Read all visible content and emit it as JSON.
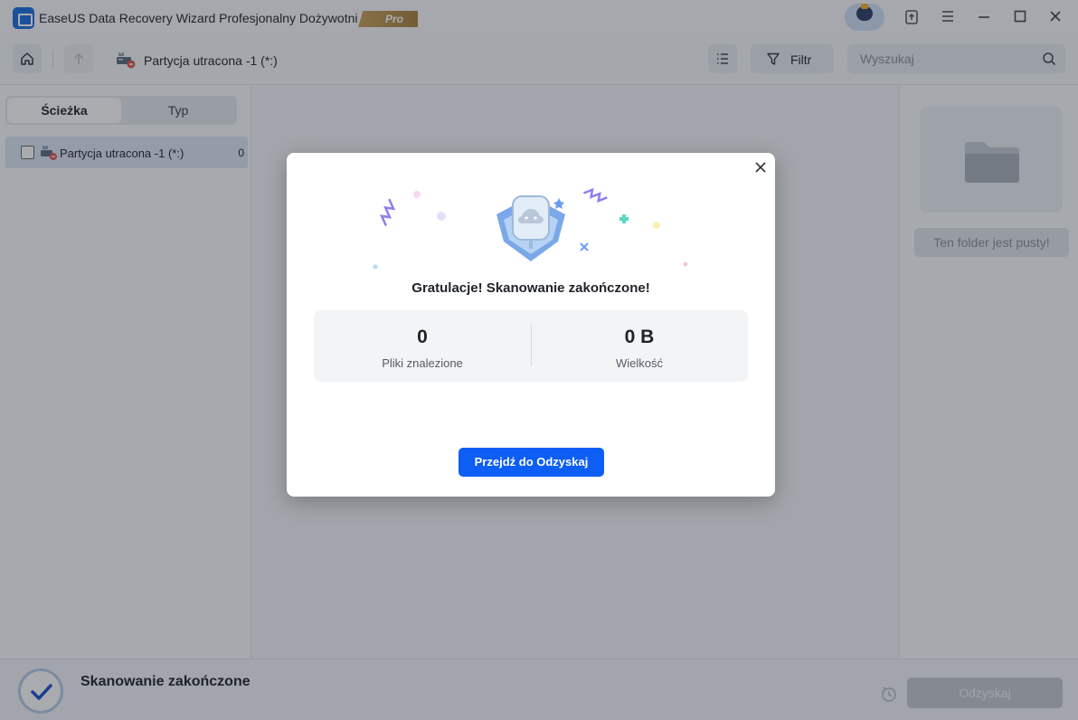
{
  "titlebar": {
    "app_title": "EaseUS Data Recovery Wizard Profesjonalny Dożywotni",
    "pro_badge": "Pro"
  },
  "toolbar": {
    "location": "Partycja utracona -1 (*:)",
    "filter_label": "Filtr",
    "search_placeholder": "Wyszukaj"
  },
  "left_panel": {
    "tabs": [
      {
        "label": "Ścieżka",
        "active": true
      },
      {
        "label": "Typ",
        "active": false
      }
    ],
    "tree": [
      {
        "label": "Partycja utracona -1 (*:)",
        "count": "0"
      }
    ]
  },
  "right_panel": {
    "empty_label": "Ten folder jest pusty!"
  },
  "bottombar": {
    "status": "Skanowanie zakończone",
    "recover_label": "Odzyskaj"
  },
  "modal": {
    "title": "Gratulacje! Skanowanie zakończone!",
    "files_found_value": "0",
    "files_found_label": "Pliki znalezione",
    "size_value": "0 B",
    "size_label": "Wielkość",
    "button_label": "Przejdź do Odzyskaj"
  },
  "colors": {
    "accent": "#0d5ef4",
    "overlay": "#1e232d",
    "disabled_button": "#c4c9d0"
  },
  "icons": [
    "app-icon",
    "pro-badge",
    "avatar",
    "upload-icon",
    "menu-icon",
    "minimize-icon",
    "maximize-icon",
    "close-icon",
    "home-icon",
    "up-arrow-icon",
    "drive-icon",
    "list-view-icon",
    "filter-icon",
    "search-icon",
    "folder-icon",
    "checkmark-icon",
    "history-icon",
    "trophy-icon"
  ]
}
